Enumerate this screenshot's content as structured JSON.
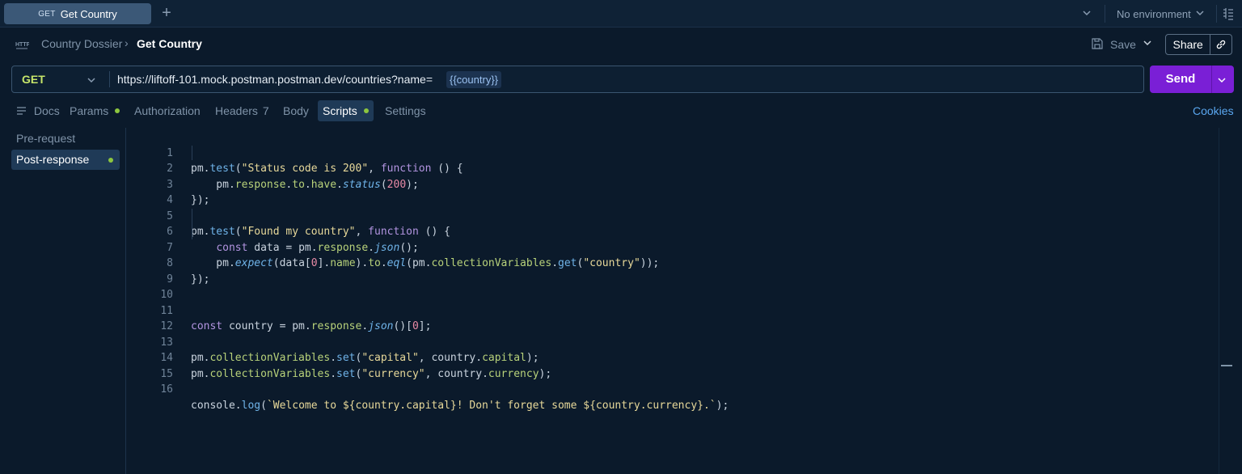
{
  "tabstrip": {
    "active_tab": {
      "method": "GET",
      "name": "Get Country"
    },
    "new_tab": "+",
    "environment": "No environment"
  },
  "breadcrumb": {
    "collection": "Country Dossier",
    "separator": "›",
    "request": "Get Country"
  },
  "actions": {
    "save_label": "Save",
    "share_label": "Share"
  },
  "request": {
    "method": "GET",
    "url": "https://liftoff-101.mock.postman.postman.dev/countries?name=",
    "url_variable": "{{country}}",
    "send_label": "Send"
  },
  "request_tabs": [
    {
      "label": "Docs"
    },
    {
      "label": "Params"
    },
    {
      "label": "Authorization"
    },
    {
      "label": "Headers",
      "count": "7"
    },
    {
      "label": "Body"
    },
    {
      "label": "Scripts"
    },
    {
      "label": "Settings"
    }
  ],
  "cookies_label": "Cookies",
  "scripts_sidebar": [
    {
      "label": "Pre-request"
    },
    {
      "label": "Post-response"
    }
  ],
  "editor": {
    "line_numbers": [
      "1",
      "2",
      "3",
      "4",
      "5",
      "6",
      "7",
      "8",
      "9",
      "10",
      "11",
      "12",
      "13",
      "14",
      "15",
      "16"
    ],
    "lines": [
      "pm.test(\"Status code is 200\", function () {",
      "    pm.response.to.have.status(200);",
      "});",
      "",
      "pm.test(\"Found my country\", function () {",
      "    const data = pm.response.json();",
      "    pm.expect(data[0].name).to.eql(pm.collectionVariables.get(\"country\"));",
      "});",
      "",
      "",
      "const country = pm.response.json()[0];",
      "",
      "pm.collectionVariables.set(\"capital\", country.capital);",
      "pm.collectionVariables.set(\"currency\", country.currency);",
      "",
      "console.log(`Welcome to ${country.capital}! Don't forget some ${country.currency}.`);"
    ]
  },
  "colors": {
    "background": "#0b1a2b",
    "send_button": "#7a1fd6",
    "method_get": "#c6e56a",
    "link": "#5aa7f0",
    "status_dot": "#8dc63f"
  }
}
